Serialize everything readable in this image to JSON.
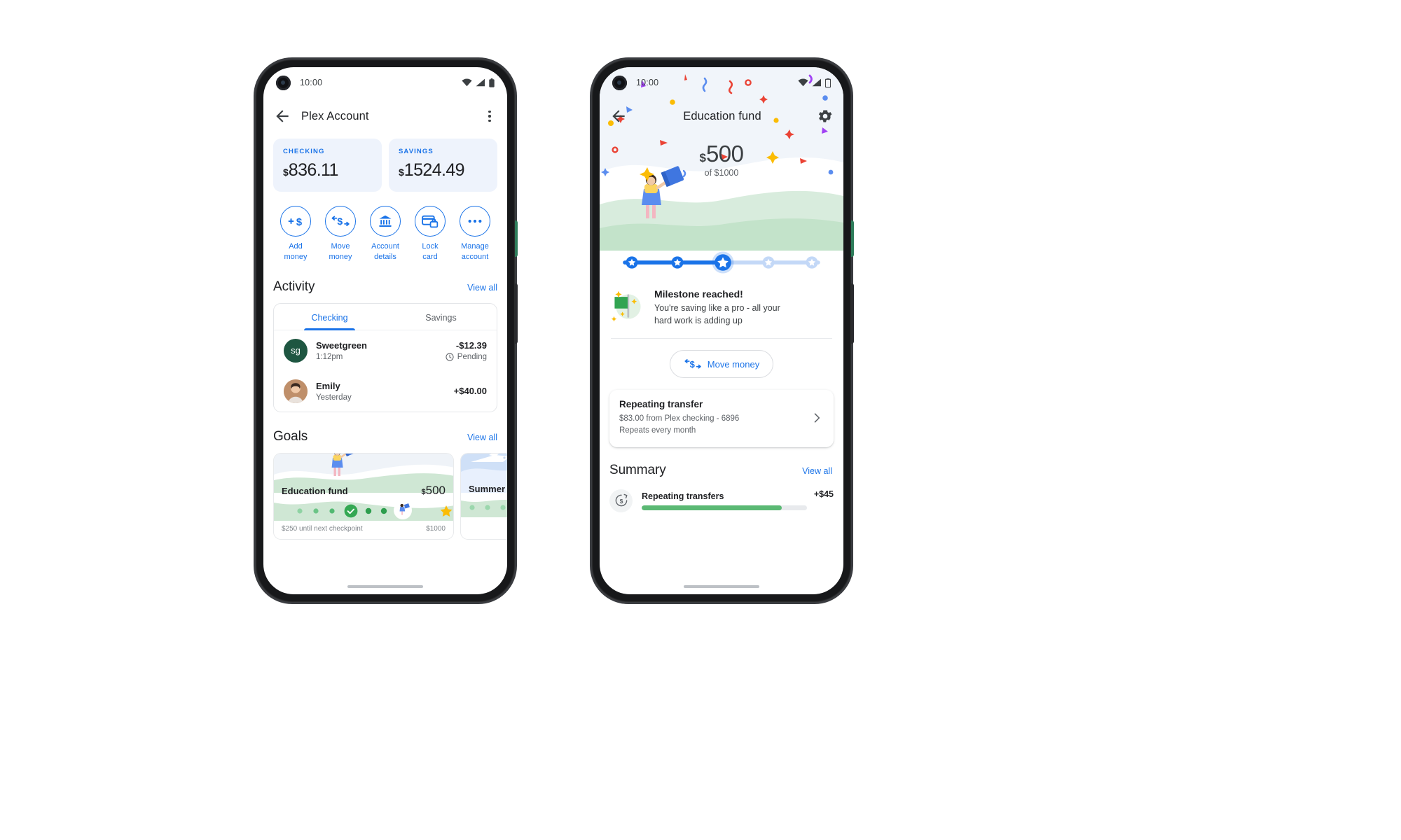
{
  "colors": {
    "blue": "#1a73e8",
    "blue_light": "#c3d8f7",
    "green": "#34a853",
    "green_bar": "#5bb974",
    "text": "#202124",
    "muted": "#5f6368",
    "card_bg": "#eef3fc",
    "hero_bg": "#f1f5fa",
    "sweetgreen": "#1e5641",
    "star_gold": "#fbbc04"
  },
  "phone1": {
    "status": {
      "time": "10:00",
      "wifi_icon": "wifi-icon",
      "signal_icon": "signal-icon",
      "battery_icon": "battery-icon"
    },
    "appbar": {
      "back_icon": "back-arrow-icon",
      "title": "Plex Account",
      "menu_icon": "overflow-menu-icon"
    },
    "balances": [
      {
        "label": "CHECKING",
        "currency": "$",
        "amount": "836.11"
      },
      {
        "label": "SAVINGS",
        "currency": "$",
        "amount": "1524.49"
      }
    ],
    "actions": [
      {
        "icon": "add-money-icon",
        "line1": "Add",
        "line2": "money"
      },
      {
        "icon": "move-money-icon",
        "line1": "Move",
        "line2": "money"
      },
      {
        "icon": "bank-icon",
        "line1": "Account",
        "line2": "details"
      },
      {
        "icon": "lock-card-icon",
        "line1": "Lock",
        "line2": "card"
      },
      {
        "icon": "more-icon",
        "line1": "Manage",
        "line2": "account"
      }
    ],
    "activity": {
      "title": "Activity",
      "view_all": "View all",
      "tabs": [
        {
          "label": "Checking",
          "active": true
        },
        {
          "label": "Savings",
          "active": false
        }
      ],
      "transactions": [
        {
          "avatar_type": "initials",
          "avatar_text": "sg",
          "avatar_color": "#1e5641",
          "name": "Sweetgreen",
          "time": "1:12pm",
          "amount": "-$12.39",
          "status": "Pending",
          "status_icon": "clock-icon"
        },
        {
          "avatar_type": "photo",
          "avatar_text": "",
          "avatar_color": "#c08a62",
          "name": "Emily",
          "time": "Yesterday",
          "amount": "+$40.00",
          "status": "",
          "status_icon": ""
        }
      ]
    },
    "goals": {
      "title": "Goals",
      "view_all": "View all",
      "cards": [
        {
          "name": "Education fund",
          "currency": "$",
          "amount": "500",
          "footer_left": "$250 until next checkpoint",
          "footer_right": "$1000",
          "dots_total": 11,
          "check_index": 4,
          "marker_index": 7,
          "star_index": 10
        },
        {
          "name": "Summer",
          "currency": "",
          "amount": "",
          "footer_left": "",
          "footer_right": ""
        }
      ]
    }
  },
  "phone2": {
    "status": {
      "time": "10:00",
      "wifi_icon": "wifi-icon",
      "signal_icon": "signal-icon",
      "battery_icon": "battery-icon"
    },
    "appbar": {
      "back_icon": "back-arrow-icon",
      "title": "Education fund",
      "settings_icon": "gear-icon"
    },
    "hero": {
      "currency": "$",
      "amount": "500",
      "of_label": "of $1000"
    },
    "slider": {
      "total_stops": 5,
      "current_index": 2
    },
    "milestone": {
      "icon": "green-flag-icon",
      "title": "Milestone reached!",
      "body_line1": "You're saving like a pro - all your",
      "body_line2": "hard work is adding up"
    },
    "move_button": {
      "icon": "move-money-icon",
      "label": "Move money"
    },
    "repeating": {
      "title": "Repeating transfer",
      "line1": "$83.00 from Plex checking - 6896",
      "line2": "Repeats every month",
      "chevron_icon": "chevron-right-icon"
    },
    "summary": {
      "title": "Summary",
      "view_all": "View all",
      "rows": [
        {
          "icon": "repeat-dollar-icon",
          "name": "Repeating transfers",
          "amount": "+$45",
          "progress_pct": 85
        }
      ]
    }
  }
}
